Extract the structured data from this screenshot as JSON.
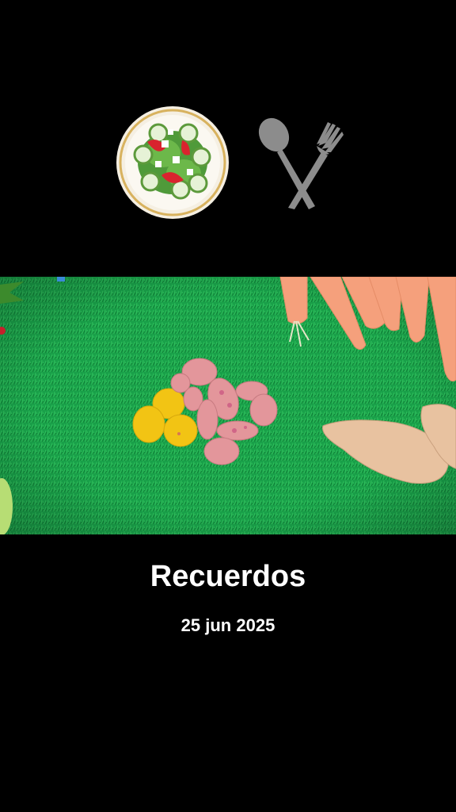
{
  "header": {
    "plate_icon": "salad-plate-icon",
    "utensils_icon": "spoon-fork-icon"
  },
  "media": {
    "description_icon": "photo-memory"
  },
  "memory": {
    "title": "Recuerdos",
    "date": "25 jun 2025"
  },
  "colors": {
    "background": "#000000",
    "text": "#ffffff",
    "grass": "#1aa34a"
  }
}
